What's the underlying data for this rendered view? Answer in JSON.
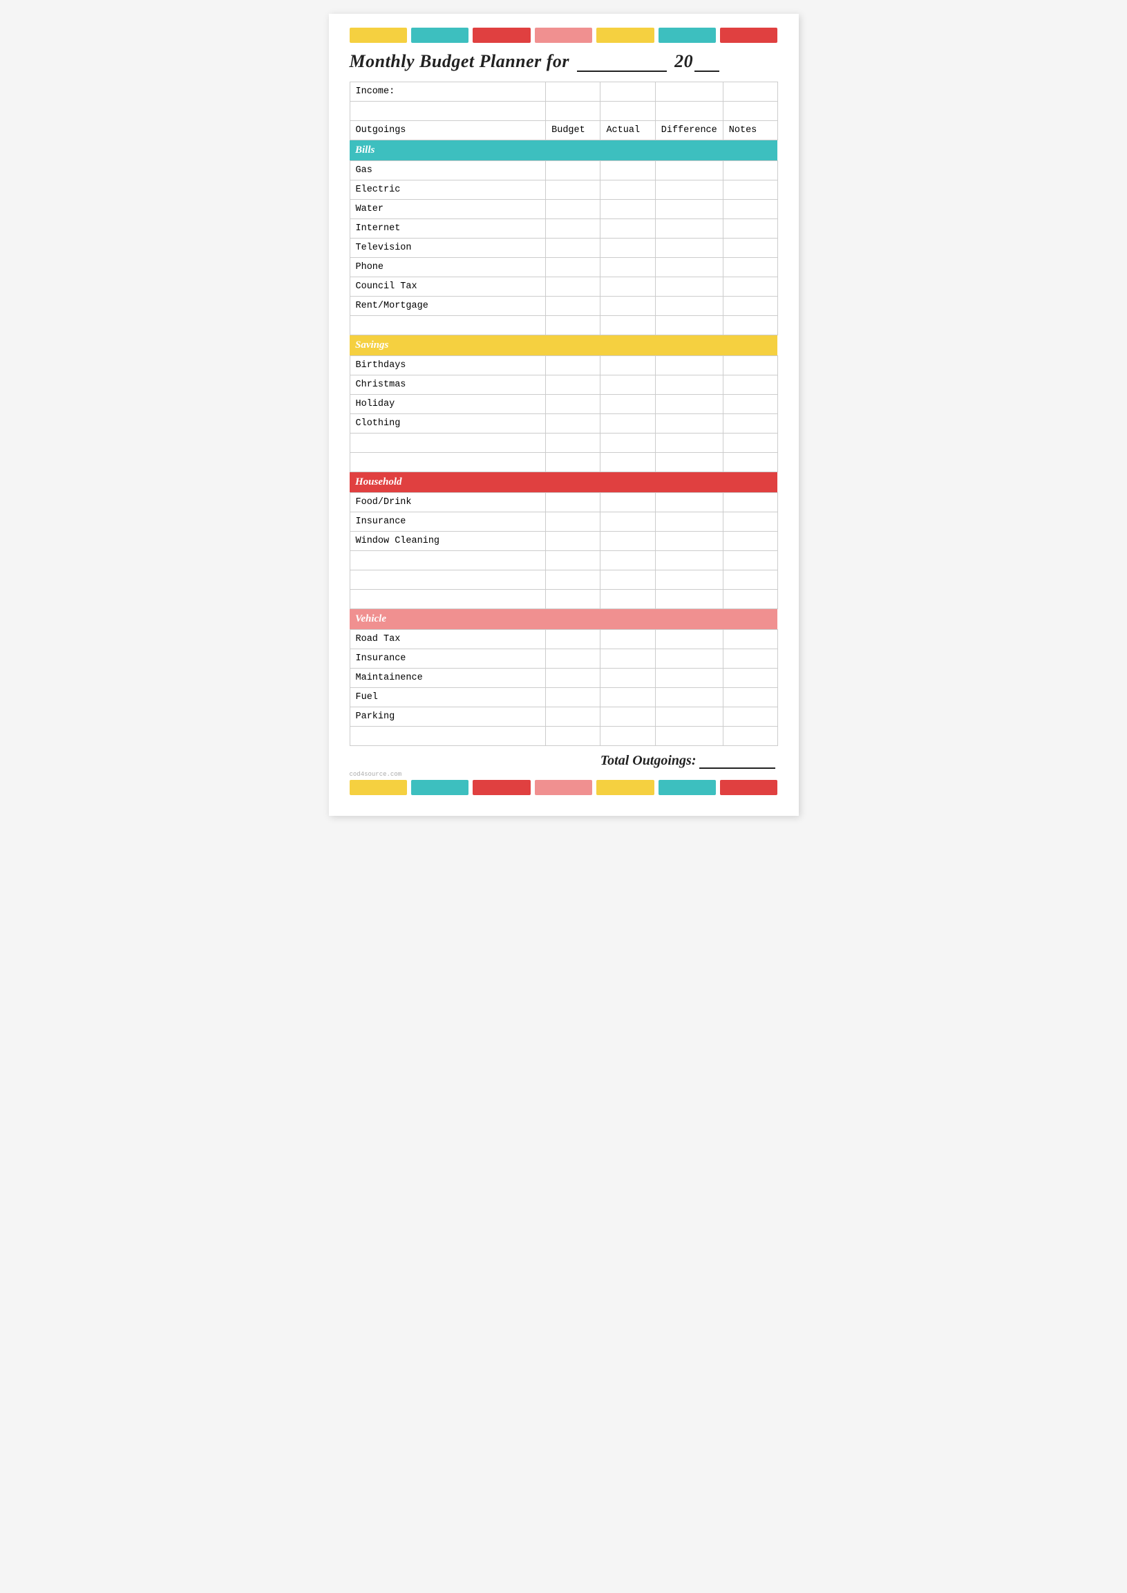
{
  "title": {
    "text": "Monthly Budget Planner for",
    "year_prefix": "20"
  },
  "colorBarsTop": [
    {
      "color": "cb-yellow",
      "label": "yellow-block"
    },
    {
      "color": "cb-teal",
      "label": "teal-block"
    },
    {
      "color": "cb-red",
      "label": "red-block"
    },
    {
      "color": "cb-pink",
      "label": "pink-block"
    },
    {
      "color": "cb-yellow2",
      "label": "yellow2-block"
    },
    {
      "color": "cb-teal2",
      "label": "teal2-block"
    },
    {
      "color": "cb-red2",
      "label": "red2-block"
    }
  ],
  "table": {
    "income_label": "Income:",
    "columns": {
      "outgoings": "Outgoings",
      "budget": "Budget",
      "actual": "Actual",
      "difference": "Difference",
      "notes": "Notes"
    },
    "sections": [
      {
        "name": "Bills",
        "color": "bg-teal",
        "items": [
          "Gas",
          "Electric",
          "Water",
          "Internet",
          "Television",
          "Phone",
          "Council Tax",
          "Rent/Mortgage",
          ""
        ]
      },
      {
        "name": "Savings",
        "color": "bg-yellow",
        "items": [
          "Birthdays",
          "Christmas",
          "Holiday",
          "Clothing",
          "",
          ""
        ]
      },
      {
        "name": "Household",
        "color": "bg-red",
        "items": [
          "Food/Drink",
          "Insurance",
          "Window Cleaning",
          "",
          "",
          ""
        ]
      },
      {
        "name": "Vehicle",
        "color": "bg-pink",
        "items": [
          "Road Tax",
          "Insurance",
          "Maintainence",
          "Fuel",
          "Parking",
          ""
        ]
      }
    ]
  },
  "total": {
    "label": "Total Outgoings:"
  },
  "watermark": "cod4source.com"
}
